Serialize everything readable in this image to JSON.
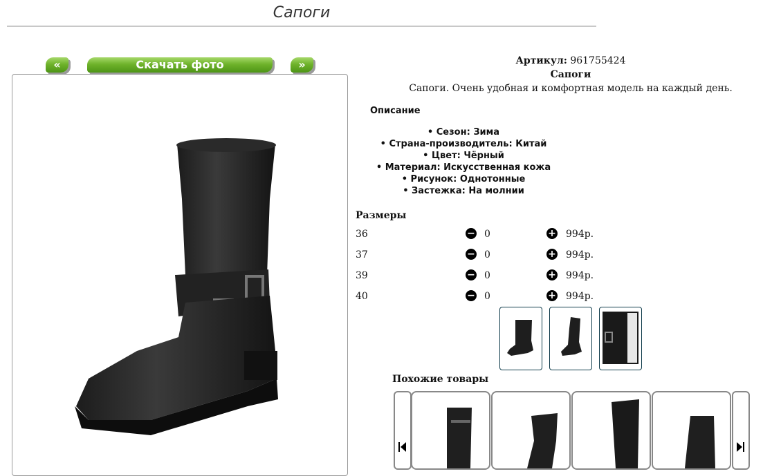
{
  "page": {
    "title": "Сапоги"
  },
  "gallery": {
    "prev_label": "«",
    "download_label": "Скачать фото",
    "next_label": "»"
  },
  "product": {
    "sku_label": "Артикул:",
    "sku_value": "961755424",
    "name": "Сапоги",
    "short_description": "Сапоги. Очень удобная и комфортная модель на каждый день.",
    "description_title": "Описание",
    "features": [
      "Сезон: Зима",
      "Страна-производитель: Китай",
      "Цвет: Чёрный",
      "Материал: Искусственная кожа",
      "Рисунок: Однотонные",
      "Застежка: На молнии"
    ]
  },
  "sizes": {
    "title": "Размеры",
    "rows": [
      {
        "size": "36",
        "qty": "0",
        "price": "994р."
      },
      {
        "size": "37",
        "qty": "0",
        "price": "994р."
      },
      {
        "size": "39",
        "qty": "0",
        "price": "994р."
      },
      {
        "size": "40",
        "qty": "0",
        "price": "994р."
      }
    ]
  },
  "similar": {
    "title": "Похожие товары"
  },
  "icons": {
    "minus": "minus-circle-icon",
    "plus": "plus-circle-icon",
    "prev": "skip-back-icon",
    "next": "skip-forward-icon"
  },
  "colors": {
    "button_green": "#6fb32b",
    "thumb_border": "#0e3b4a"
  }
}
